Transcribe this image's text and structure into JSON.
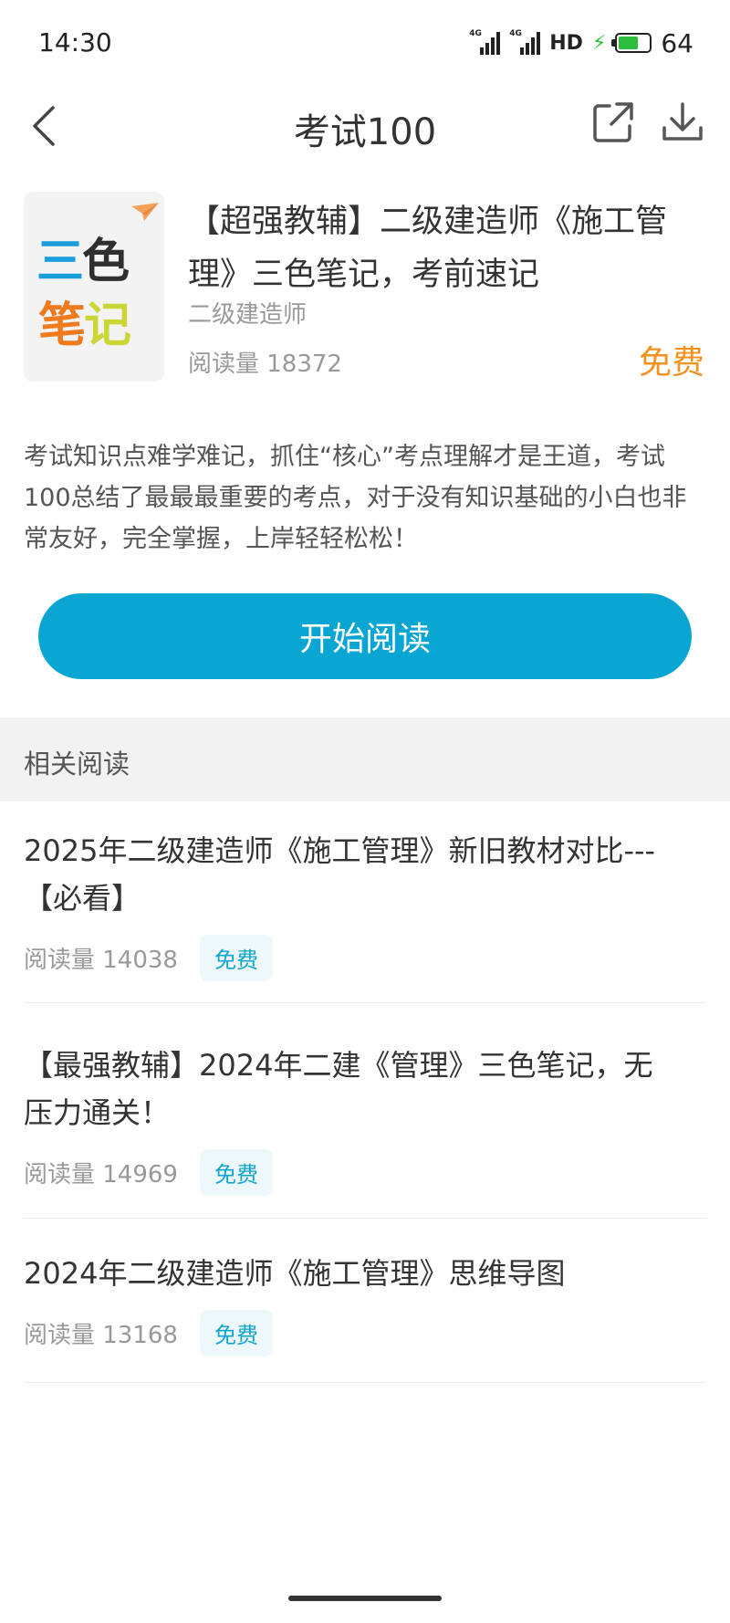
{
  "status_bar": {
    "time": "14:30",
    "network_1": "4G",
    "network_2": "4G",
    "hd": "HD",
    "battery_level": "64",
    "icons": [
      "signal-icon",
      "signal-icon",
      "hd-icon",
      "charging-icon",
      "battery-icon"
    ],
    "battery_fraction": 0.64
  },
  "nav": {
    "title": "考试100",
    "icons": [
      "back-icon",
      "share-icon",
      "download-icon"
    ]
  },
  "book": {
    "cover": {
      "line1_a": "三",
      "line1_b": "色",
      "line2_a": "笔",
      "line2_b": "记",
      "colors": {
        "blue": "#1a9ddb",
        "dark": "#2f2f2f",
        "orange": "#f07a1e",
        "green": "#c9d635"
      }
    },
    "title": "【超强教辅】二级建造师《施工管理》三色笔记，考前速记",
    "category": "二级建造师",
    "reads": "阅读量 18372",
    "price": "免费"
  },
  "description": "考试知识点难学难记，抓住“核心”考点理解才是王道，考试100总结了最最最重要的考点，对于没有知识基础的小白也非常友好，完全掌握，上岸轻轻松松！",
  "start_button": {
    "label": "开始阅读",
    "color": "#0aa6d3"
  },
  "related": {
    "title": "相关阅读",
    "items": [
      {
        "title": "2025年二级建造师《施工管理》新旧教材对比---【必看】",
        "reads": "阅读量 14038",
        "badge": "免费"
      },
      {
        "title": "【最强教辅】2024年二建《管理》三色笔记，无压力通关！",
        "reads": "阅读量 14969",
        "badge": "免费"
      },
      {
        "title": "2024年二级建造师《施工管理》思维导图",
        "reads": "阅读量 13168",
        "badge": "免费"
      }
    ]
  },
  "accent_colors": {
    "price": "#f5911e",
    "badge_text": "#12a5cf",
    "badge_bg": "#eef8fb"
  }
}
